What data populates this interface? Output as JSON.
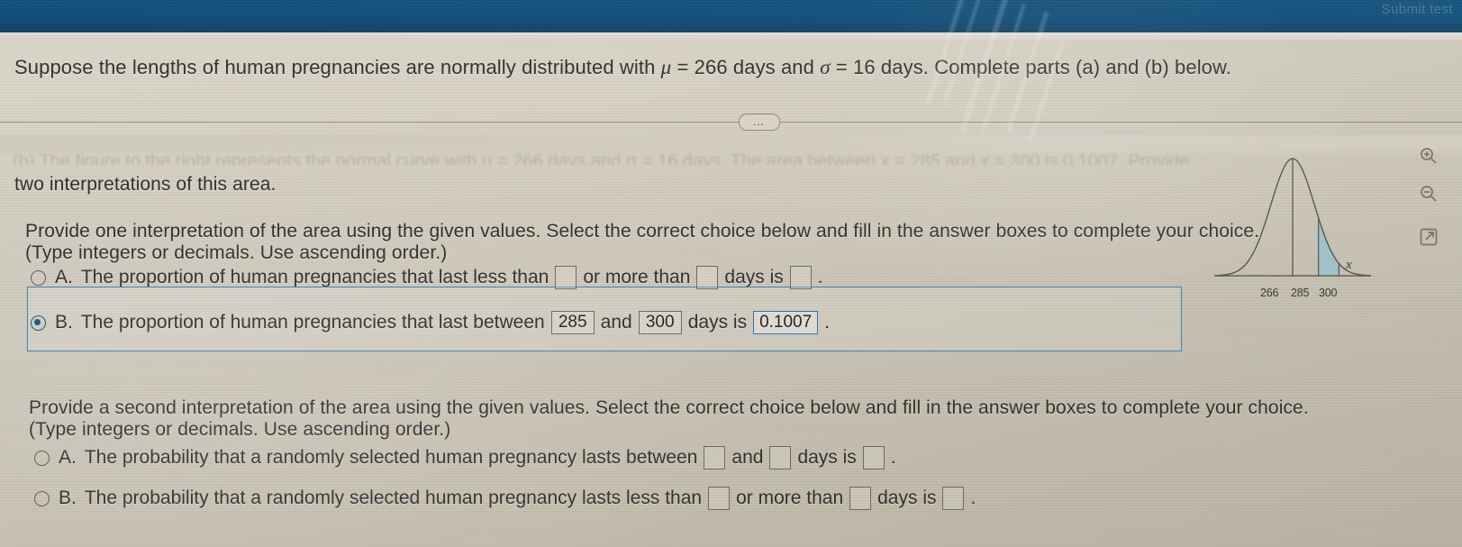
{
  "window": {
    "topbar_ghost_text": "Submit test"
  },
  "question": {
    "stem_part1": "Suppose the lengths of human pregnancies are normally distributed with",
    "mu_symbol": "μ",
    "mu_text": "= 266 days and",
    "sigma_symbol": "σ",
    "sigma_text": "= 16 days. Complete parts (a) and (b) below.",
    "faded_line": "(b) The figure to the right represents the normal curve with μ = 266 days and σ = 16 days. The area between x = 285 and x = 300 is 0.1007. Provide",
    "two_interpretations": "two interpretations of this area.",
    "ellipsis_button": "…"
  },
  "part_one": {
    "prompt": "Provide one interpretation of the area using the given values. Select the correct choice below and fill in the answer boxes to complete your choice.",
    "instruction": "(Type integers or decimals. Use ascending order.)",
    "choices": [
      {
        "letter": "A.",
        "selected": false,
        "text_1": "The proportion of human pregnancies that last less than",
        "text_2": "or more than",
        "text_3": "days is",
        "text_4": ".",
        "value_1": "",
        "value_2": "",
        "value_3": ""
      },
      {
        "letter": "B.",
        "selected": true,
        "text_1": "The proportion of human pregnancies that last between",
        "text_2": "and",
        "text_3": "days is",
        "text_4": ".",
        "value_1": "285",
        "value_2": "300",
        "value_3": "0.1007"
      }
    ]
  },
  "part_two": {
    "prompt": "Provide a second interpretation of the area using the given values. Select the correct choice below and fill in the answer boxes to complete your choice.",
    "instruction": "(Type integers or decimals. Use ascending order.)",
    "choices": [
      {
        "letter": "A.",
        "selected": false,
        "text_1": "The probability that a randomly selected human pregnancy lasts between",
        "text_2": "and",
        "text_3": "days is",
        "text_4": ".",
        "value_1": "",
        "value_2": "",
        "value_3": ""
      },
      {
        "letter": "B.",
        "selected": false,
        "text_1": "The probability that a randomly selected human pregnancy lasts less than",
        "text_2": "or more than",
        "text_3": "days is",
        "text_4": ".",
        "value_1": "",
        "value_2": "",
        "value_3": ""
      }
    ]
  },
  "chart_data": {
    "type": "area",
    "title": "",
    "xlabel": "x",
    "ylabel": "",
    "distribution": "normal",
    "mean": 266,
    "sd": 16,
    "tick_labels": [
      "266",
      "285",
      "300"
    ],
    "tick_values": [
      266,
      285,
      300
    ],
    "shaded_region": {
      "from": 285,
      "to": 300,
      "area": 0.1007,
      "color": "#9ec4cc"
    },
    "mean_line": true,
    "grid": false,
    "axis_color": "#4a4840",
    "curve_color": "#4a4840"
  },
  "toolbar": {
    "icons": [
      {
        "name": "zoom-in-icon",
        "label": "Zoom in"
      },
      {
        "name": "zoom-out-icon",
        "label": "Zoom out"
      },
      {
        "name": "open-in-new-window-icon",
        "label": "Open in new window"
      }
    ]
  },
  "colors": {
    "topbar": "#0a4a76",
    "page_bg": "#d8d3c3",
    "accent_blue": "#2f74b5",
    "shade_fill": "#9ec4cc",
    "text": "#2b2b2b"
  }
}
